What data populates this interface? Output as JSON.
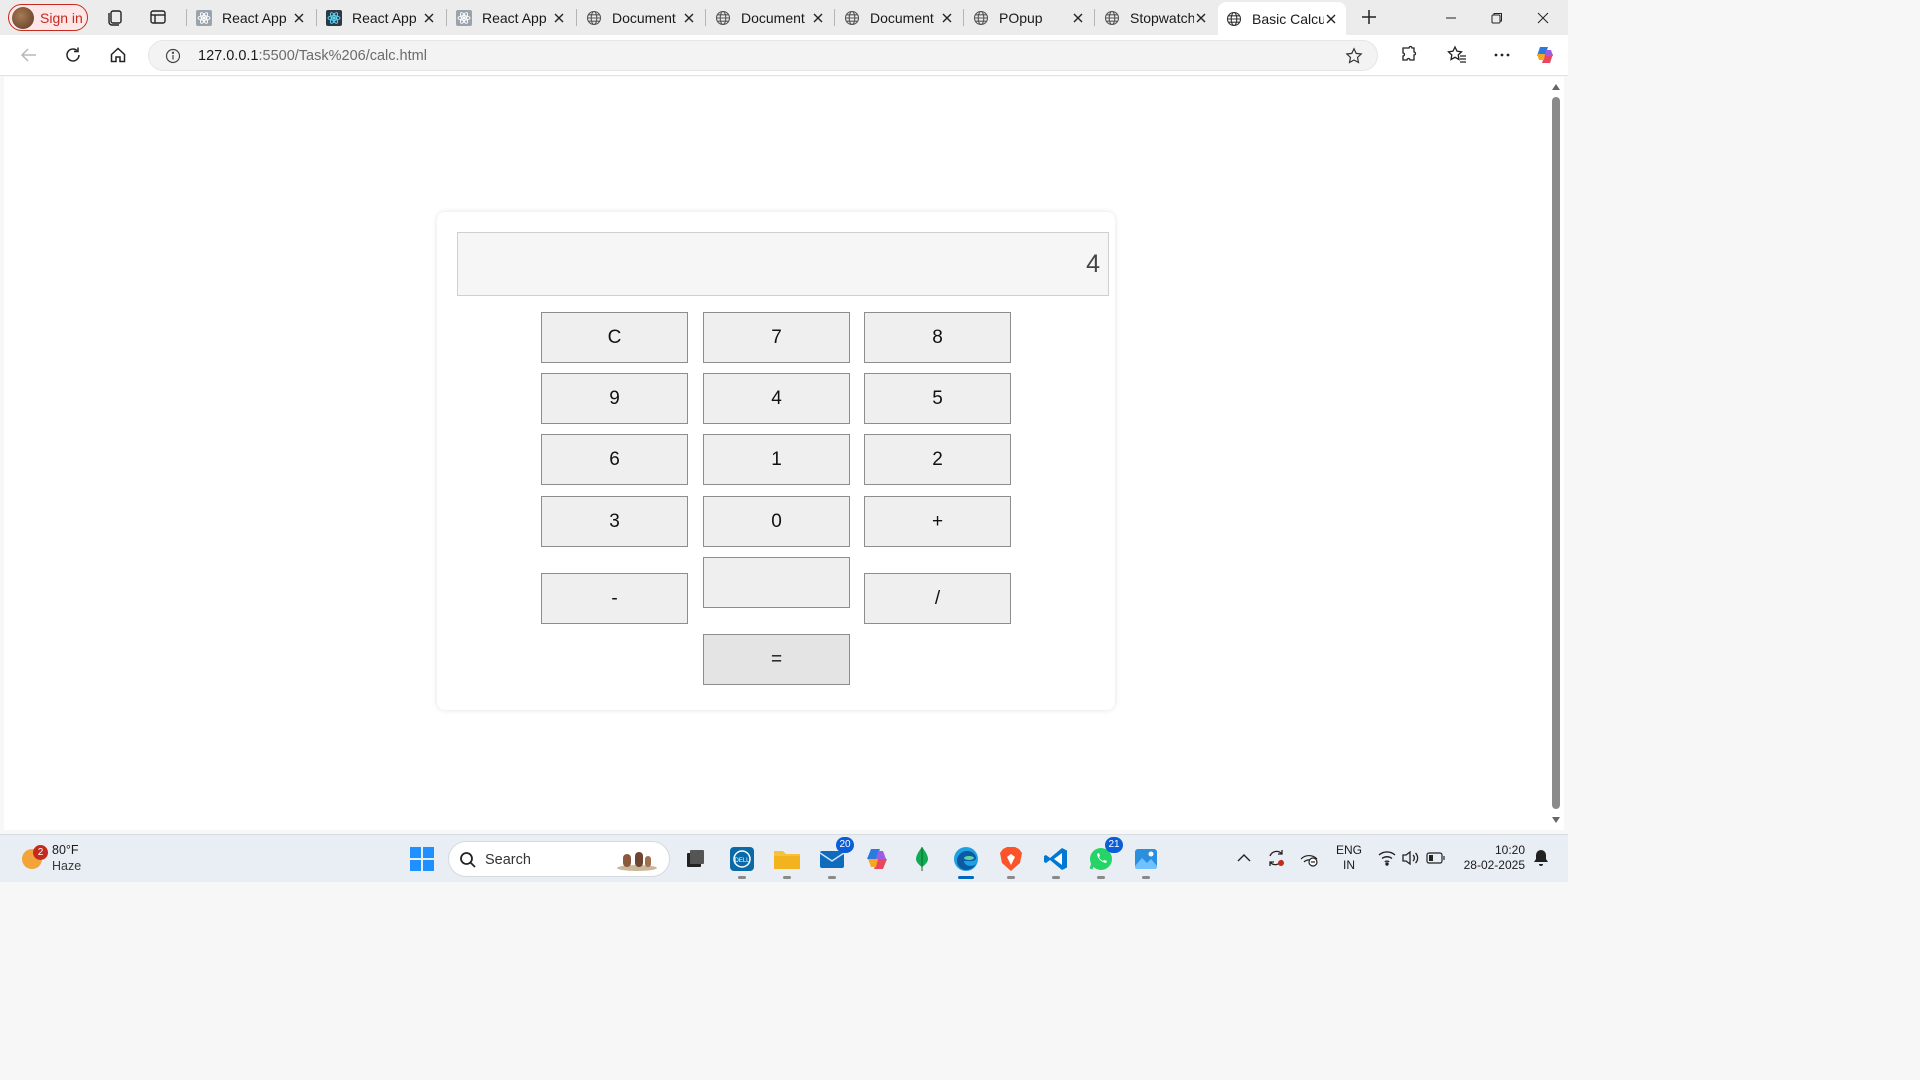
{
  "browser": {
    "signin_label": "Sign in",
    "tabs": [
      {
        "title": "React App",
        "favicon": "react-icon"
      },
      {
        "title": "React App",
        "favicon": "react-icon"
      },
      {
        "title": "React App",
        "favicon": "react-icon"
      },
      {
        "title": "Document",
        "favicon": "globe-icon"
      },
      {
        "title": "Document",
        "favicon": "globe-icon"
      },
      {
        "title": "Document",
        "favicon": "globe-icon"
      },
      {
        "title": "POpup",
        "favicon": "globe-icon"
      },
      {
        "title": "Stopwatch",
        "favicon": "globe-icon"
      },
      {
        "title": "Basic Calcula",
        "favicon": "globe-icon",
        "active": true
      }
    ],
    "url_host": "127.0.0.1",
    "url_rest": ":5500/Task%206/calc.html"
  },
  "calculator": {
    "display_value": "4",
    "keys": {
      "k1": "C",
      "k2": "7",
      "k3": "8",
      "k4": "9",
      "k5": "4",
      "k6": "5",
      "k7": "6",
      "k8": "1",
      "k9": "2",
      "k10": "3",
      "k11": "0",
      "k12": "+",
      "k13": "-",
      "k14": "",
      "k15": "/",
      "k16": "="
    }
  },
  "taskbar": {
    "weather_badge": "2",
    "temperature": "80°F",
    "condition": "Haze",
    "search_placeholder": "Search",
    "mail_badge": "20",
    "whatsapp_badge": "21",
    "lang_line1": "ENG",
    "lang_line2": "IN",
    "time": "10:20",
    "date": "28-02-2025"
  },
  "colors": {
    "accent": "#0067c0",
    "signin": "#c42b1c"
  }
}
